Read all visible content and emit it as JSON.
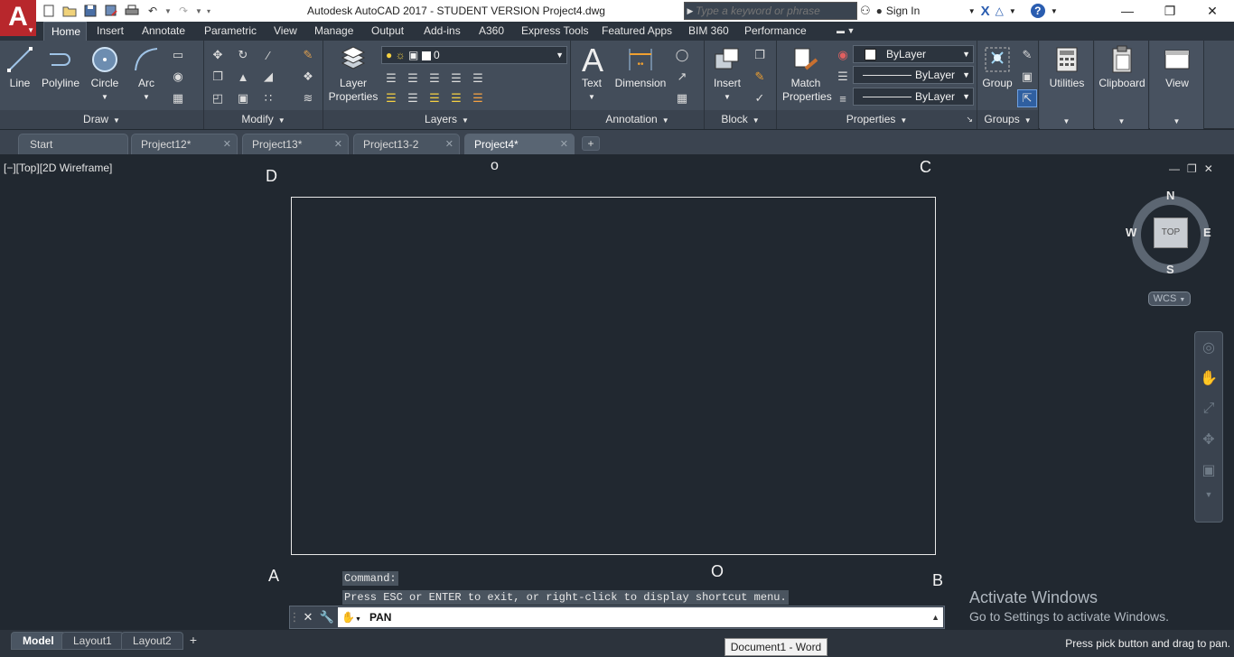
{
  "app": {
    "logo_letter": "A",
    "title": "Autodesk AutoCAD 2017 - STUDENT VERSION    Project4.dwg"
  },
  "search": {
    "placeholder": "Type a keyword or phrase"
  },
  "account": {
    "signin_label": "Sign In"
  },
  "menu_tabs": [
    "Home",
    "Insert",
    "Annotate",
    "Parametric",
    "View",
    "Manage",
    "Output",
    "Add-ins",
    "A360",
    "Express Tools",
    "Featured Apps",
    "BIM 360",
    "Performance"
  ],
  "ribbon": {
    "draw": {
      "title": "Draw",
      "line": "Line",
      "polyline": "Polyline",
      "circle": "Circle",
      "arc": "Arc"
    },
    "modify": {
      "title": "Modify"
    },
    "layers": {
      "title": "Layers",
      "layer_properties_1": "Layer",
      "layer_properties_2": "Properties",
      "current_layer": "0"
    },
    "annotation": {
      "title": "Annotation",
      "text": "Text",
      "dimension": "Dimension"
    },
    "block": {
      "title": "Block",
      "insert": "Insert"
    },
    "properties": {
      "title": "Properties",
      "match_1": "Match",
      "match_2": "Properties",
      "color": "ByLayer",
      "linetype": "ByLayer",
      "lineweight": "ByLayer"
    },
    "groups": {
      "title": "Groups",
      "group": "Group"
    },
    "utilities": {
      "label": "Utilities"
    },
    "clipboard": {
      "label": "Clipboard"
    },
    "view": {
      "label": "View"
    }
  },
  "doc_tabs": [
    "Start",
    "Project12*",
    "Project13*",
    "Project13-2",
    "Project4*"
  ],
  "viewport": {
    "label": "[−][Top][2D Wireframe]",
    "points": {
      "a": "A",
      "b": "B",
      "c": "C",
      "d": "D",
      "o_top": "o",
      "o_bottom": "O"
    }
  },
  "viewcube": {
    "top": "TOP",
    "north": "N",
    "south": "S",
    "east": "E",
    "west": "W",
    "wcs": "WCS"
  },
  "command": {
    "history_1": "Command:",
    "history_2": "Press ESC or ENTER to exit, or right-click to display shortcut menu.",
    "current": "PAN"
  },
  "watermark": {
    "line1": "Activate Windows",
    "line2": "Go to Settings to activate Windows."
  },
  "layout_tabs": [
    "Model",
    "Layout1",
    "Layout2"
  ],
  "taskbar_tooltip": "Document1 - Word",
  "status_message": "Press pick button and drag to pan.",
  "colors": {
    "accent_red": "#b8272c",
    "canvas": "#212830",
    "ribbon": "#434d5a"
  }
}
